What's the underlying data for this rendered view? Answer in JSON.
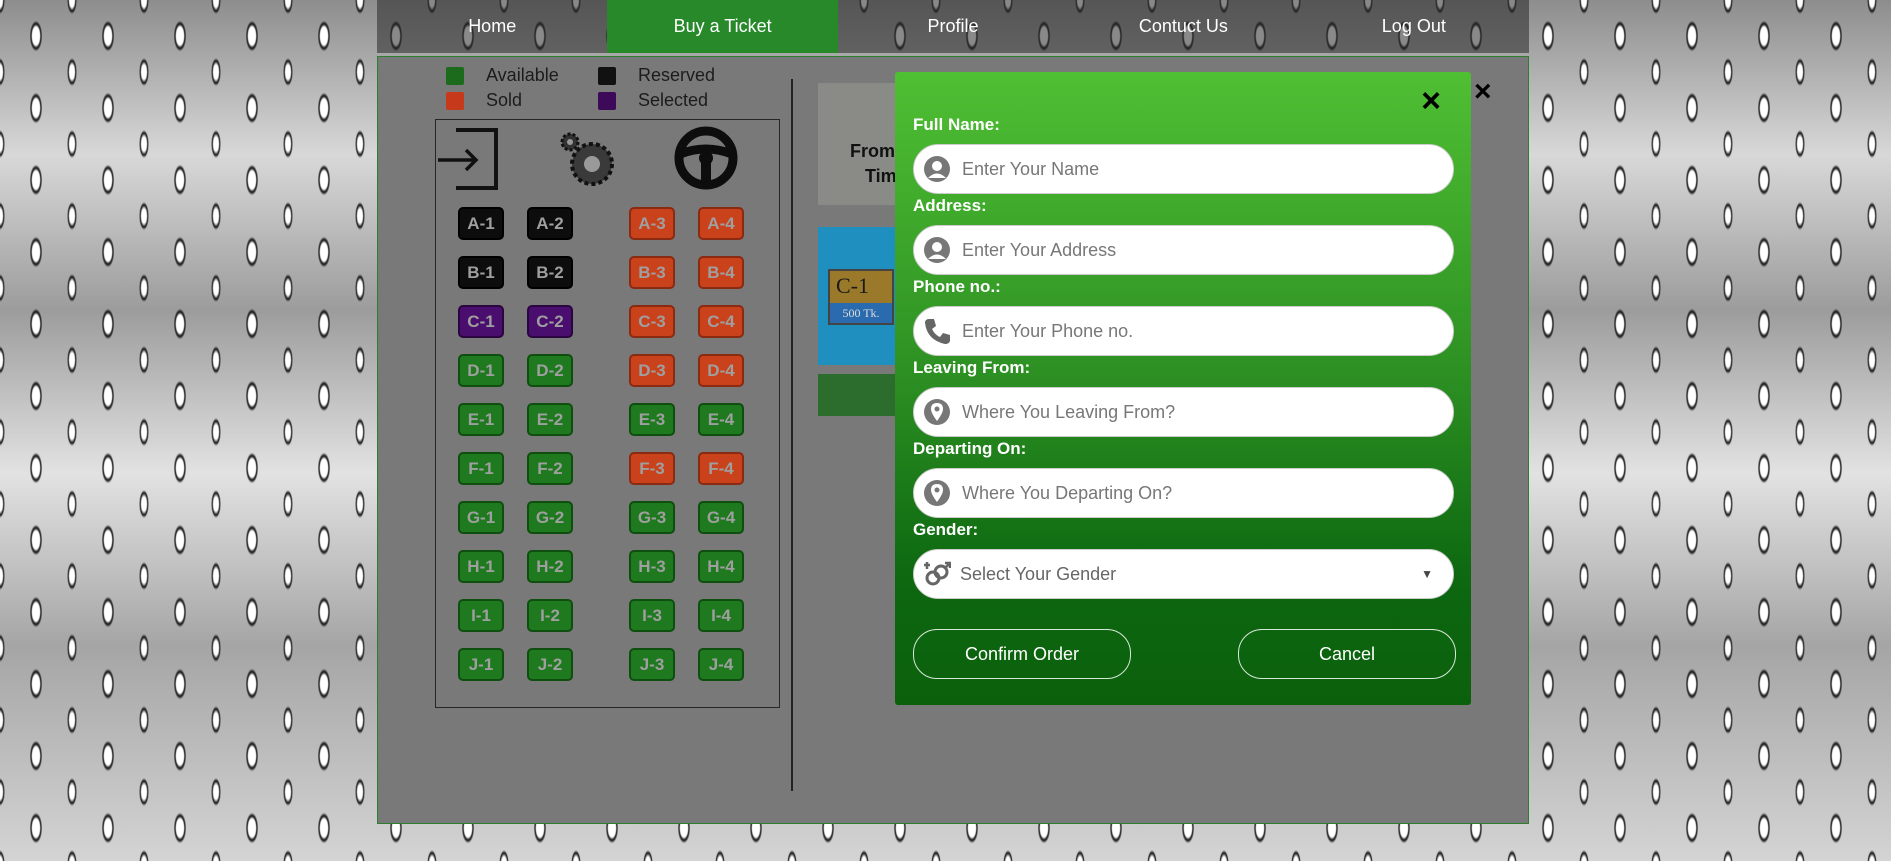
{
  "nav": {
    "items": [
      {
        "label": "Home",
        "active": false
      },
      {
        "label": "Buy a Ticket",
        "active": true
      },
      {
        "label": "Profile",
        "active": false
      },
      {
        "label": "Contuct Us",
        "active": false
      },
      {
        "label": "Log Out",
        "active": false
      }
    ]
  },
  "legend": {
    "available": "Available",
    "sold": "Sold",
    "reserved": "Reserved",
    "selected": "Selected",
    "colors": {
      "available": "#1c6b1c",
      "sold": "#c6391a",
      "reserved": "#111111",
      "selected": "#3d0a5a"
    }
  },
  "seat_map": {
    "icons": [
      "exit-icon",
      "engine-icon",
      "steering-wheel-icon"
    ],
    "rows": [
      {
        "seats": [
          {
            "label": "A-1",
            "status": "reserved"
          },
          {
            "label": "A-2",
            "status": "reserved"
          },
          {
            "label": "A-3",
            "status": "sold"
          },
          {
            "label": "A-4",
            "status": "sold"
          }
        ]
      },
      {
        "seats": [
          {
            "label": "B-1",
            "status": "reserved"
          },
          {
            "label": "B-2",
            "status": "reserved"
          },
          {
            "label": "B-3",
            "status": "sold"
          },
          {
            "label": "B-4",
            "status": "sold"
          }
        ]
      },
      {
        "seats": [
          {
            "label": "C-1",
            "status": "selected"
          },
          {
            "label": "C-2",
            "status": "selected"
          },
          {
            "label": "C-3",
            "status": "sold"
          },
          {
            "label": "C-4",
            "status": "sold"
          }
        ]
      },
      {
        "seats": [
          {
            "label": "D-1",
            "status": "available"
          },
          {
            "label": "D-2",
            "status": "available"
          },
          {
            "label": "D-3",
            "status": "sold"
          },
          {
            "label": "D-4",
            "status": "sold"
          }
        ]
      },
      {
        "seats": [
          {
            "label": "E-1",
            "status": "available"
          },
          {
            "label": "E-2",
            "status": "available"
          },
          {
            "label": "E-3",
            "status": "available"
          },
          {
            "label": "E-4",
            "status": "available"
          }
        ]
      },
      {
        "seats": [
          {
            "label": "F-1",
            "status": "available"
          },
          {
            "label": "F-2",
            "status": "available"
          },
          {
            "label": "F-3",
            "status": "sold"
          },
          {
            "label": "F-4",
            "status": "sold"
          }
        ]
      },
      {
        "seats": [
          {
            "label": "G-1",
            "status": "available"
          },
          {
            "label": "G-2",
            "status": "available"
          },
          {
            "label": "G-3",
            "status": "available"
          },
          {
            "label": "G-4",
            "status": "available"
          }
        ]
      },
      {
        "seats": [
          {
            "label": "H-1",
            "status": "available"
          },
          {
            "label": "H-2",
            "status": "available"
          },
          {
            "label": "H-3",
            "status": "available"
          },
          {
            "label": "H-4",
            "status": "available"
          }
        ]
      },
      {
        "seats": [
          {
            "label": "I-1",
            "status": "available"
          },
          {
            "label": "I-2",
            "status": "available"
          },
          {
            "label": "I-3",
            "status": "available"
          },
          {
            "label": "I-4",
            "status": "available"
          }
        ]
      },
      {
        "seats": [
          {
            "label": "J-1",
            "status": "available"
          },
          {
            "label": "J-2",
            "status": "available"
          },
          {
            "label": "J-3",
            "status": "available"
          },
          {
            "label": "J-4",
            "status": "available"
          }
        ]
      }
    ]
  },
  "trip_info": {
    "line1": "From",
    "line2": "Tim"
  },
  "ticket": {
    "seat": "C-1",
    "price": "500 Tk."
  },
  "modal": {
    "close": "×",
    "fields": {
      "full_name": {
        "label": "Full Name:",
        "placeholder": "Enter Your Name",
        "value": ""
      },
      "address": {
        "label": "Address:",
        "placeholder": "Enter Your Address",
        "value": ""
      },
      "phone": {
        "label": "Phone no.:",
        "placeholder": "Enter Your Phone no.",
        "value": ""
      },
      "leaving_from": {
        "label": "Leaving From:",
        "placeholder": "Where You Leaving From?",
        "value": ""
      },
      "departing_on": {
        "label": "Departing On:",
        "placeholder": "Where You Departing On?",
        "value": ""
      },
      "gender": {
        "label": "Gender:",
        "selected": "Select Your Gender"
      }
    },
    "confirm_label": "Confirm Order",
    "cancel_label": "Cancel"
  },
  "panel_close": "×"
}
